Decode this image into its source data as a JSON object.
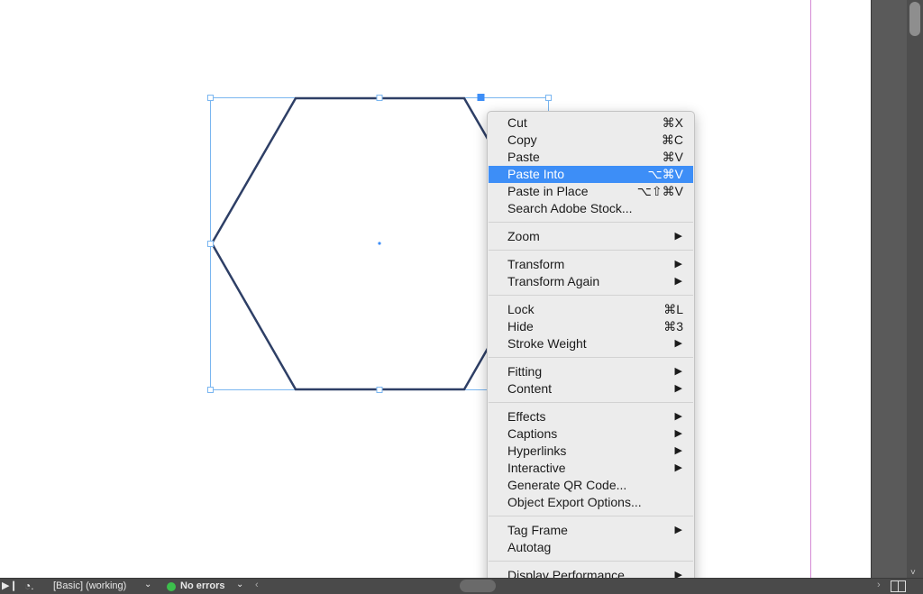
{
  "colors": {
    "accent": "#3d8ef7",
    "shape_stroke": "#2e3f66",
    "selection": "#7ab6f0",
    "margin_guide": "#d58ad5",
    "status_ok": "#3cbf4c"
  },
  "context_menu": {
    "groups": [
      [
        {
          "label": "Cut",
          "shortcut": "⌘X"
        },
        {
          "label": "Copy",
          "shortcut": "⌘C"
        },
        {
          "label": "Paste",
          "shortcut": "⌘V"
        },
        {
          "label": "Paste Into",
          "shortcut": "⌥⌘V",
          "highlighted": true
        },
        {
          "label": "Paste in Place",
          "shortcut": "⌥⇧⌘V"
        },
        {
          "label": "Search Adobe Stock...",
          "shortcut": ""
        }
      ],
      [
        {
          "label": "Zoom",
          "submenu": true
        }
      ],
      [
        {
          "label": "Transform",
          "submenu": true
        },
        {
          "label": "Transform Again",
          "submenu": true
        }
      ],
      [
        {
          "label": "Lock",
          "shortcut": "⌘L"
        },
        {
          "label": "Hide",
          "shortcut": "⌘3"
        },
        {
          "label": "Stroke Weight",
          "submenu": true
        }
      ],
      [
        {
          "label": "Fitting",
          "submenu": true
        },
        {
          "label": "Content",
          "submenu": true
        }
      ],
      [
        {
          "label": "Effects",
          "submenu": true
        },
        {
          "label": "Captions",
          "submenu": true
        },
        {
          "label": "Hyperlinks",
          "submenu": true
        },
        {
          "label": "Interactive",
          "submenu": true
        },
        {
          "label": "Generate QR Code...",
          "shortcut": ""
        },
        {
          "label": "Object Export Options...",
          "shortcut": ""
        }
      ],
      [
        {
          "label": "Tag Frame",
          "submenu": true
        },
        {
          "label": "Autotag",
          "shortcut": ""
        }
      ],
      [
        {
          "label": "Display Performance",
          "submenu": true
        }
      ]
    ]
  },
  "status_bar": {
    "play_icon": "play-icon",
    "preflight_icon": "preflight-icon",
    "profile": "[Basic] (working)",
    "errors": "No errors"
  }
}
